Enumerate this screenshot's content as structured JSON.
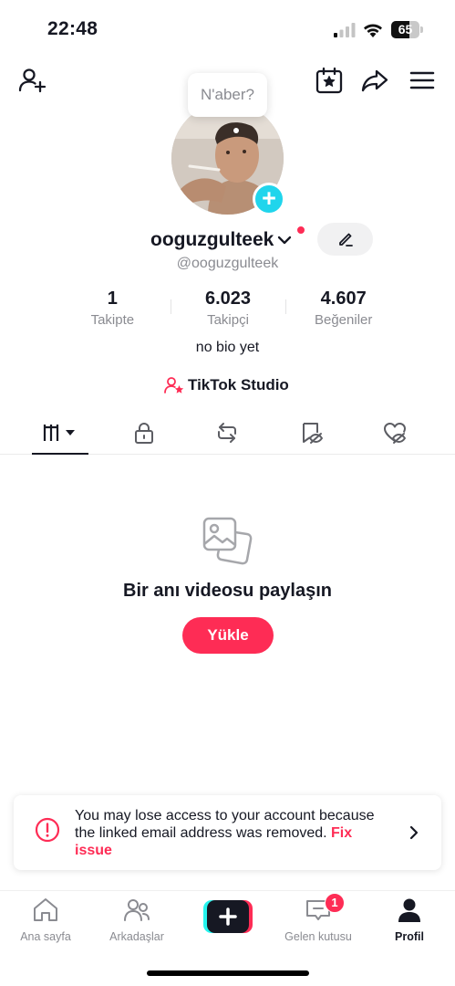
{
  "status_bar": {
    "time": "22:48",
    "battery": "65",
    "battery_level": 0.65,
    "icons": [
      "signal-icon",
      "wifi-icon",
      "battery-icon"
    ]
  },
  "top_bar": {
    "icons": [
      "add-friend-icon",
      "calendar-star-icon",
      "share-icon",
      "menu-icon"
    ]
  },
  "profile": {
    "note_bubble": "N'aber?",
    "username": "ooguzgulteek",
    "handle": "@ooguzgulteek",
    "bio": "no bio yet",
    "studio_label": "TikTok Studio"
  },
  "stats": [
    {
      "value": "1",
      "label": "Takipte"
    },
    {
      "value": "6.023",
      "label": "Takipçi"
    },
    {
      "value": "4.607",
      "label": "Beğeniler"
    }
  ],
  "tabs": [
    "videos-grid-icon",
    "lock-icon",
    "repost-icon",
    "hidden-likes-icon",
    "liked-hidden-icon"
  ],
  "empty_state": {
    "title": "Bir anı videosu paylaşın",
    "button": "Yükle"
  },
  "alert": {
    "text": "You may lose access to your account because the linked email address was removed.",
    "link": "Fix issue"
  },
  "bottom_nav": {
    "items": [
      {
        "label": "Ana sayfa",
        "icon": "home-icon"
      },
      {
        "label": "Arkadaşlar",
        "icon": "friends-icon"
      },
      {
        "label": "",
        "icon": "create-plus-icon"
      },
      {
        "label": "Gelen kutusu",
        "icon": "inbox-icon",
        "badge": "1"
      },
      {
        "label": "Profil",
        "icon": "profile-icon"
      }
    ]
  },
  "colors": {
    "accent": "#fe2c55",
    "cyan": "#20d5ec",
    "text": "#161823",
    "muted": "#8a8b91"
  }
}
